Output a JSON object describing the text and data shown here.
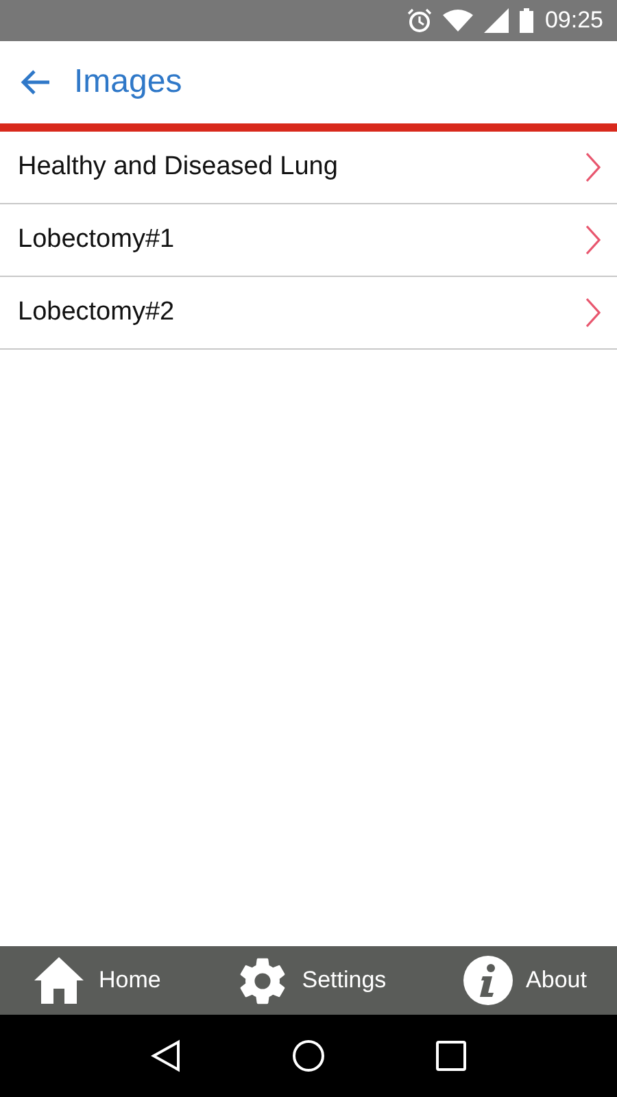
{
  "status_bar": {
    "time": "09:25"
  },
  "header": {
    "title": "Images"
  },
  "items": [
    {
      "label": "Healthy and Diseased Lung"
    },
    {
      "label": "Lobectomy#1"
    },
    {
      "label": "Lobectomy#2"
    }
  ],
  "bottom_nav": [
    {
      "kind": "home",
      "label": "Home"
    },
    {
      "kind": "settings",
      "label": "Settings"
    },
    {
      "kind": "info",
      "label": "About"
    }
  ]
}
